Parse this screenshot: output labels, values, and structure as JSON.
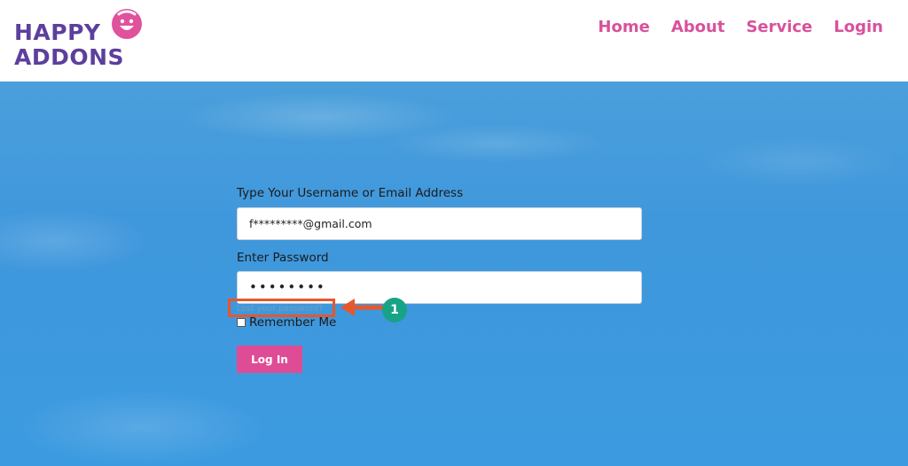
{
  "brand": {
    "line1": "HAPPY",
    "line2": "ADDONS",
    "colors": {
      "purple": "#5d3f9c",
      "pink": "#e0529c"
    }
  },
  "nav": {
    "items": [
      {
        "label": "Home"
      },
      {
        "label": "About"
      },
      {
        "label": "Service"
      },
      {
        "label": "Login"
      }
    ],
    "color": "#d8519c"
  },
  "form": {
    "username_label": "Type Your Username or Email Address",
    "username_value": "f*********@gmail.com",
    "password_label": "Enter Password",
    "password_value": "••••••••",
    "remember_label": "Remember Me",
    "remember_checked": false,
    "submit_label": "Log In",
    "lost_password_label": "Lost your password?"
  },
  "annotation": {
    "step_number": "1",
    "highlight_color": "#e8562b",
    "badge_color": "#17a386"
  }
}
